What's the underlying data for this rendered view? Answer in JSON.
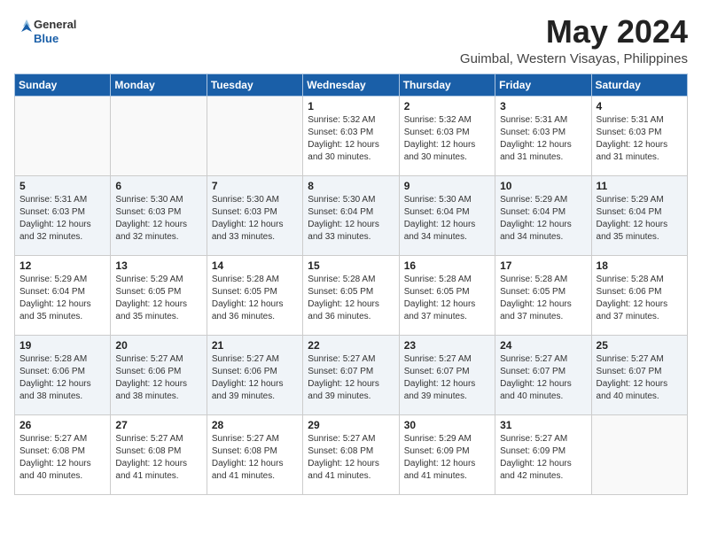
{
  "logo": {
    "general": "General",
    "blue": "Blue"
  },
  "header": {
    "month": "May 2024",
    "location": "Guimbal, Western Visayas, Philippines"
  },
  "weekdays": [
    "Sunday",
    "Monday",
    "Tuesday",
    "Wednesday",
    "Thursday",
    "Friday",
    "Saturday"
  ],
  "weeks": [
    [
      {
        "day": "",
        "info": ""
      },
      {
        "day": "",
        "info": ""
      },
      {
        "day": "",
        "info": ""
      },
      {
        "day": "1",
        "info": "Sunrise: 5:32 AM\nSunset: 6:03 PM\nDaylight: 12 hours\nand 30 minutes."
      },
      {
        "day": "2",
        "info": "Sunrise: 5:32 AM\nSunset: 6:03 PM\nDaylight: 12 hours\nand 30 minutes."
      },
      {
        "day": "3",
        "info": "Sunrise: 5:31 AM\nSunset: 6:03 PM\nDaylight: 12 hours\nand 31 minutes."
      },
      {
        "day": "4",
        "info": "Sunrise: 5:31 AM\nSunset: 6:03 PM\nDaylight: 12 hours\nand 31 minutes."
      }
    ],
    [
      {
        "day": "5",
        "info": "Sunrise: 5:31 AM\nSunset: 6:03 PM\nDaylight: 12 hours\nand 32 minutes."
      },
      {
        "day": "6",
        "info": "Sunrise: 5:30 AM\nSunset: 6:03 PM\nDaylight: 12 hours\nand 32 minutes."
      },
      {
        "day": "7",
        "info": "Sunrise: 5:30 AM\nSunset: 6:03 PM\nDaylight: 12 hours\nand 33 minutes."
      },
      {
        "day": "8",
        "info": "Sunrise: 5:30 AM\nSunset: 6:04 PM\nDaylight: 12 hours\nand 33 minutes."
      },
      {
        "day": "9",
        "info": "Sunrise: 5:30 AM\nSunset: 6:04 PM\nDaylight: 12 hours\nand 34 minutes."
      },
      {
        "day": "10",
        "info": "Sunrise: 5:29 AM\nSunset: 6:04 PM\nDaylight: 12 hours\nand 34 minutes."
      },
      {
        "day": "11",
        "info": "Sunrise: 5:29 AM\nSunset: 6:04 PM\nDaylight: 12 hours\nand 35 minutes."
      }
    ],
    [
      {
        "day": "12",
        "info": "Sunrise: 5:29 AM\nSunset: 6:04 PM\nDaylight: 12 hours\nand 35 minutes."
      },
      {
        "day": "13",
        "info": "Sunrise: 5:29 AM\nSunset: 6:05 PM\nDaylight: 12 hours\nand 35 minutes."
      },
      {
        "day": "14",
        "info": "Sunrise: 5:28 AM\nSunset: 6:05 PM\nDaylight: 12 hours\nand 36 minutes."
      },
      {
        "day": "15",
        "info": "Sunrise: 5:28 AM\nSunset: 6:05 PM\nDaylight: 12 hours\nand 36 minutes."
      },
      {
        "day": "16",
        "info": "Sunrise: 5:28 AM\nSunset: 6:05 PM\nDaylight: 12 hours\nand 37 minutes."
      },
      {
        "day": "17",
        "info": "Sunrise: 5:28 AM\nSunset: 6:05 PM\nDaylight: 12 hours\nand 37 minutes."
      },
      {
        "day": "18",
        "info": "Sunrise: 5:28 AM\nSunset: 6:06 PM\nDaylight: 12 hours\nand 37 minutes."
      }
    ],
    [
      {
        "day": "19",
        "info": "Sunrise: 5:28 AM\nSunset: 6:06 PM\nDaylight: 12 hours\nand 38 minutes."
      },
      {
        "day": "20",
        "info": "Sunrise: 5:27 AM\nSunset: 6:06 PM\nDaylight: 12 hours\nand 38 minutes."
      },
      {
        "day": "21",
        "info": "Sunrise: 5:27 AM\nSunset: 6:06 PM\nDaylight: 12 hours\nand 39 minutes."
      },
      {
        "day": "22",
        "info": "Sunrise: 5:27 AM\nSunset: 6:07 PM\nDaylight: 12 hours\nand 39 minutes."
      },
      {
        "day": "23",
        "info": "Sunrise: 5:27 AM\nSunset: 6:07 PM\nDaylight: 12 hours\nand 39 minutes."
      },
      {
        "day": "24",
        "info": "Sunrise: 5:27 AM\nSunset: 6:07 PM\nDaylight: 12 hours\nand 40 minutes."
      },
      {
        "day": "25",
        "info": "Sunrise: 5:27 AM\nSunset: 6:07 PM\nDaylight: 12 hours\nand 40 minutes."
      }
    ],
    [
      {
        "day": "26",
        "info": "Sunrise: 5:27 AM\nSunset: 6:08 PM\nDaylight: 12 hours\nand 40 minutes."
      },
      {
        "day": "27",
        "info": "Sunrise: 5:27 AM\nSunset: 6:08 PM\nDaylight: 12 hours\nand 41 minutes."
      },
      {
        "day": "28",
        "info": "Sunrise: 5:27 AM\nSunset: 6:08 PM\nDaylight: 12 hours\nand 41 minutes."
      },
      {
        "day": "29",
        "info": "Sunrise: 5:27 AM\nSunset: 6:08 PM\nDaylight: 12 hours\nand 41 minutes."
      },
      {
        "day": "30",
        "info": "Sunrise: 5:29 AM\nSunset: 6:09 PM\nDaylight: 12 hours\nand 41 minutes."
      },
      {
        "day": "31",
        "info": "Sunrise: 5:27 AM\nSunset: 6:09 PM\nDaylight: 12 hours\nand 42 minutes."
      },
      {
        "day": "",
        "info": ""
      }
    ]
  ]
}
